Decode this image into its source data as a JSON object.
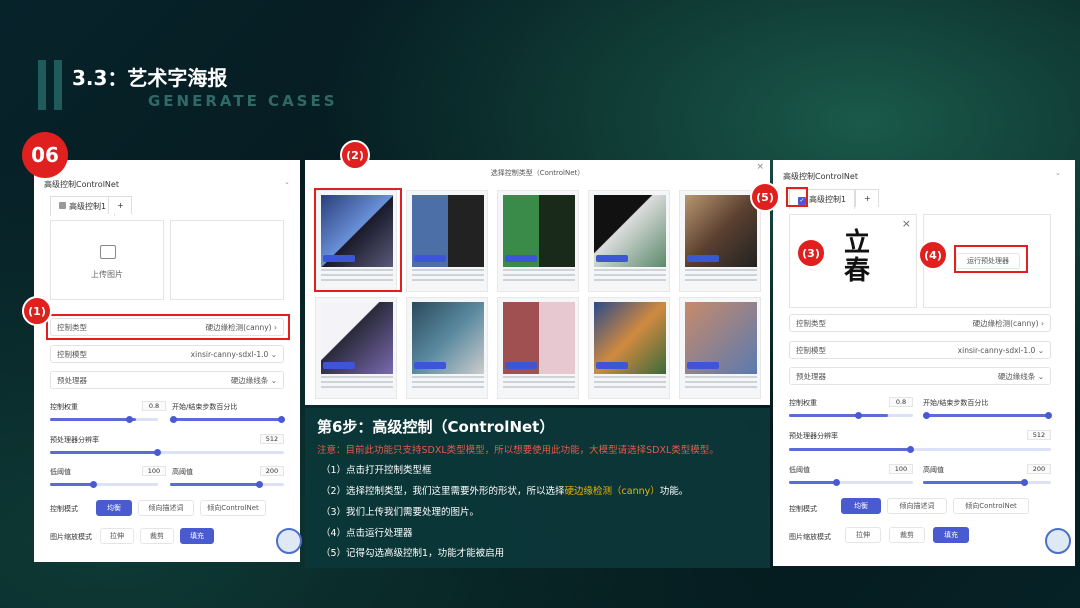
{
  "header": {
    "title": "3.3：艺术字海报",
    "subtitle": "GENERATE CASES"
  },
  "badges": {
    "main": "06",
    "b1": "(1)",
    "b2": "(2)",
    "b3": "(3)",
    "b4": "(4)",
    "b5": "(5)"
  },
  "left_panel": {
    "section": "高级控制ControlNet",
    "tab": "高级控制1",
    "add": "+",
    "upload": "上传图片",
    "control_type_label": "控制类型",
    "control_type_value": "硬边缘检测(canny)",
    "control_model_label": "控制模型",
    "control_model_value": "xinsir-canny-sdxl-1.0",
    "preprocessor_label": "预处理器",
    "preprocessor_value": "硬边缘线条",
    "weight_label": "控制权重",
    "weight_value": "0.8",
    "range_label": "开始/结束步数百分比",
    "resolution_label": "预处理器分辨率",
    "resolution_value": "512",
    "low_label": "低阈值",
    "low_value": "100",
    "high_label": "高阈值",
    "high_value": "200",
    "mode_label": "控制模式",
    "modes": [
      "均衡",
      "倾向描述词",
      "倾向ControlNet"
    ],
    "scale_label": "图片缩放模式",
    "scales": [
      "拉伸",
      "裁剪",
      "填充"
    ]
  },
  "selector": {
    "title": "选择控制类型（ControlNet）",
    "close": "×"
  },
  "step": {
    "title": "第6步：高级控制（ControlNet）",
    "note": "注意：目前此功能只支持SDXL类型模型，所以想要使用此功能，大模型请选择SDXL类型模型。",
    "items": [
      "（1）点击打开控制类型框",
      "（2）选择控制类型，我们这里需要外形的形状，所以选择",
      "（3）我们上传我们需要处理的图片。",
      "（4）点击运行处理器",
      "（5）记得勾选高级控制1，功能才能被启用"
    ],
    "highlight": "硬边缘检测（canny）",
    "item2_tail": "功能。"
  },
  "right_panel": {
    "section": "高级控制ControlNet",
    "tab": "高级控制1",
    "add": "+",
    "calligraphy": "立春",
    "close": "×",
    "run_button": "运行预处理器",
    "control_type_label": "控制类型",
    "control_type_value": "硬边缘检测(canny)",
    "control_model_label": "控制模型",
    "control_model_value": "xinsir-canny-sdxl-1.0",
    "preprocessor_label": "预处理器",
    "preprocessor_value": "硬边缘线条",
    "weight_label": "控制权重",
    "weight_value": "0.8",
    "range_label": "开始/结束步数百分比",
    "resolution_label": "预处理器分辨率",
    "resolution_value": "512",
    "low_label": "低阈值",
    "low_value": "100",
    "high_label": "高阈值",
    "high_value": "200",
    "mode_label": "控制模式",
    "modes": [
      "均衡",
      "倾向描述词",
      "倾向ControlNet"
    ],
    "scale_label": "图片缩放模式",
    "scales": [
      "拉伸",
      "裁剪",
      "填充"
    ]
  },
  "colors": {
    "accent": "#4a5bd0",
    "badge": "#e0201e",
    "highlight": "#f0b400",
    "note": "#e85b4a"
  }
}
